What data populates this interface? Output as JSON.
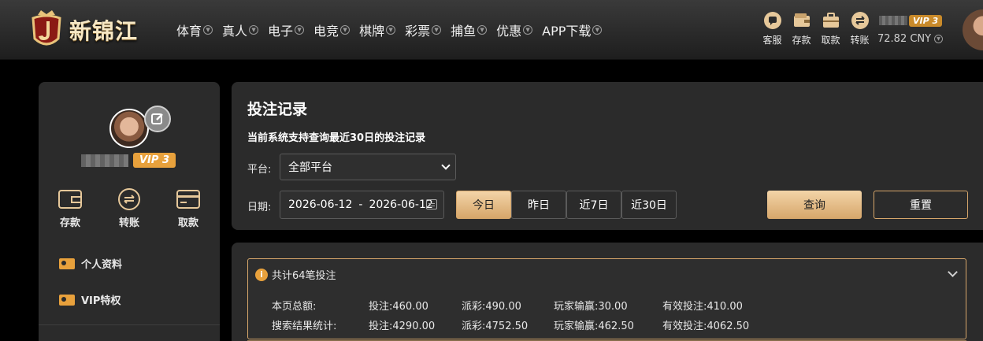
{
  "brand": {
    "name": "新锦江"
  },
  "nav": {
    "items": [
      "体育",
      "真人",
      "电子",
      "电竞",
      "棋牌",
      "彩票",
      "捕鱼",
      "优惠",
      "APP下载"
    ]
  },
  "header_tools": [
    {
      "label": "客服",
      "icon": "chat-icon"
    },
    {
      "label": "存款",
      "icon": "wallet-icon"
    },
    {
      "label": "取款",
      "icon": "briefcase-icon"
    },
    {
      "label": "转账",
      "icon": "transfer-icon"
    }
  ],
  "account": {
    "vip": "VIP 3",
    "balance": "72.82 CNY"
  },
  "sidebar": {
    "vip": "VIP 3",
    "quick": [
      "存款",
      "转账",
      "取款"
    ],
    "menu": [
      "个人资料",
      "VIP特权"
    ]
  },
  "filter": {
    "title": "投注记录",
    "note": "当前系统支持查询最近30日的投注记录",
    "platform_label": "平台:",
    "platform_value": "全部平台",
    "date_label": "日期:",
    "date_from": "2026-06-12",
    "date_to": "2026-06-12",
    "date_sep": "-",
    "quick_ranges": [
      "今日",
      "昨日",
      "近7日",
      "近30日"
    ],
    "active_range": "今日",
    "query_label": "查询",
    "reset_label": "重置"
  },
  "summary": {
    "header": "共计64笔投注",
    "rows": [
      {
        "label": "本页总额:",
        "bet": "投注:460.00",
        "payout": "派彩:490.00",
        "win": "玩家输赢:30.00",
        "valid": "有效投注:410.00"
      },
      {
        "label": "搜索结果统计:",
        "bet": "投注:4290.00",
        "payout": "派彩:4752.50",
        "win": "玩家输赢:462.50",
        "valid": "有效投注:4062.50"
      }
    ]
  },
  "colors": {
    "accent": "#d6a66a",
    "vip": "#e8a13c",
    "panel": "#2b2b2b"
  }
}
